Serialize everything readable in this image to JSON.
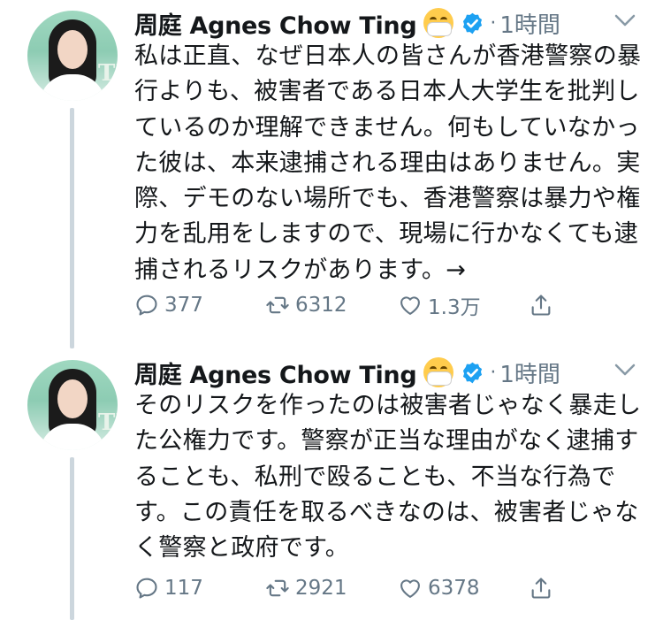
{
  "tweets": [
    {
      "author": "周庭 Agnes Chow Ting",
      "time": "1時間",
      "text": "私は正直、なぜ日本人の皆さんが香港警察の暴行よりも、被害者である日本人大学生を批判しているのか理解できません。何もしていなかった彼は、本来逮捕される理由はありません。実際、デモのない場所でも、香港警察は暴力や権力を乱用をしますので、現場に行かなくても逮捕されるリスクがあります。→",
      "replies": "377",
      "retweets": "6312",
      "likes": "1.3万"
    },
    {
      "author": "周庭 Agnes Chow Ting",
      "time": "1時間",
      "text": "そのリスクを作ったのは被害者じゃなく暴走した公権力です。警察が正当な理由がなく逮捕することも、私刑で殴ることも、不当な行為です。この責任を取るべきなのは、被害者じゃなく警察と政府です。",
      "replies": "117",
      "retweets": "2921",
      "likes": "6378"
    }
  ],
  "icons": {
    "emoji": "face-with-medical-mask-icon",
    "verified": "verified-badge-icon",
    "menu": "chevron-down-icon",
    "reply": "reply-icon",
    "retweet": "retweet-icon",
    "like": "heart-icon",
    "share": "share-icon"
  },
  "colors": {
    "text": "#14171a",
    "secondary": "#657786",
    "verified": "#1da1f2",
    "thread_line": "#ccd6dd"
  }
}
